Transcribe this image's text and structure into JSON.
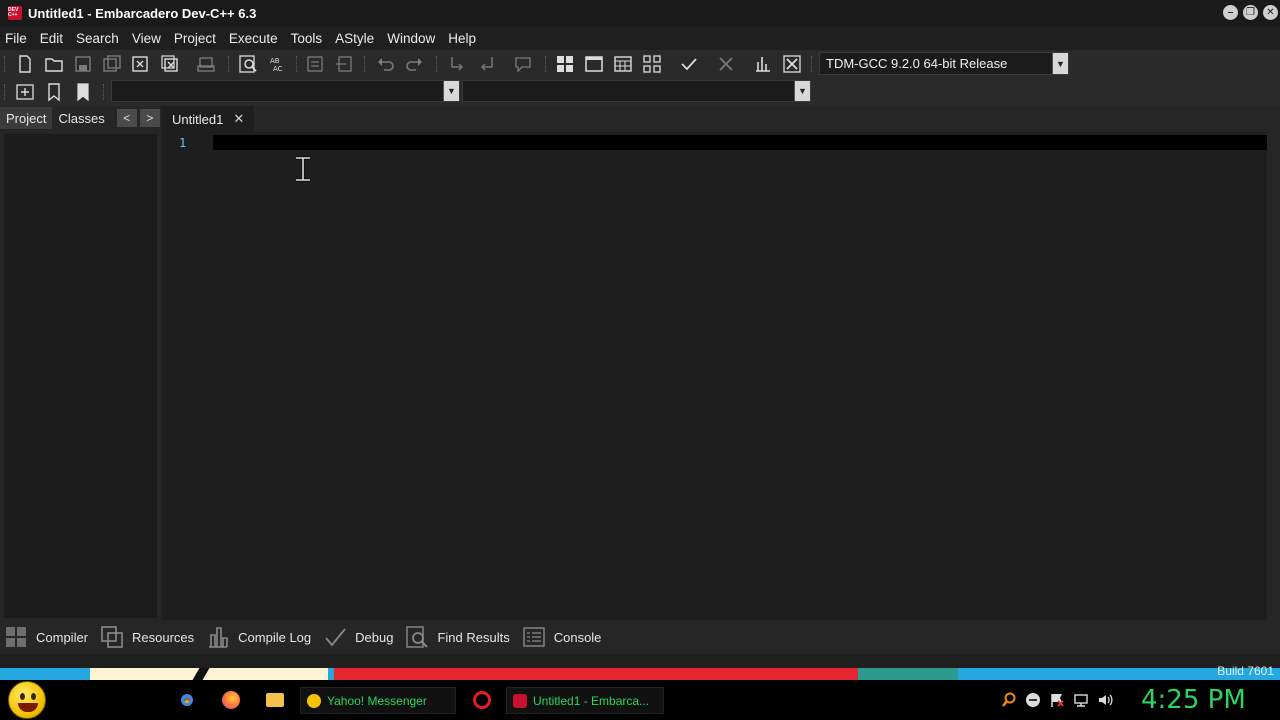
{
  "window": {
    "title": "Untitled1 - Embarcadero Dev-C++ 6.3",
    "app_icon_text": "DEV C++"
  },
  "menu": [
    "File",
    "Edit",
    "Search",
    "View",
    "Project",
    "Execute",
    "Tools",
    "AStyle",
    "Window",
    "Help"
  ],
  "toolbar": {
    "compiler_select": "TDM-GCC 9.2.0 64-bit Release"
  },
  "left_panel": {
    "tabs": [
      "Project",
      "Classes"
    ],
    "nav_prev": "<",
    "nav_next": ">"
  },
  "editor": {
    "tab_label": "Untitled1",
    "tab_close": "✕",
    "line_numbers": [
      "1"
    ]
  },
  "bottom_tabs": [
    "Compiler",
    "Resources",
    "Compile Log",
    "Debug",
    "Find Results",
    "Console"
  ],
  "status": {
    "build": "Build 7601"
  },
  "taskbar": {
    "tasks": [
      "Yahoo! Messenger",
      "Untitled1 - Embarca..."
    ],
    "clock": "4:25 PM"
  },
  "colors": {
    "accent_green": "#29d65f",
    "line_number": "#7fb7ff",
    "wallpaper_blue": "#25a8e0",
    "wallpaper_red": "#e3262f"
  }
}
